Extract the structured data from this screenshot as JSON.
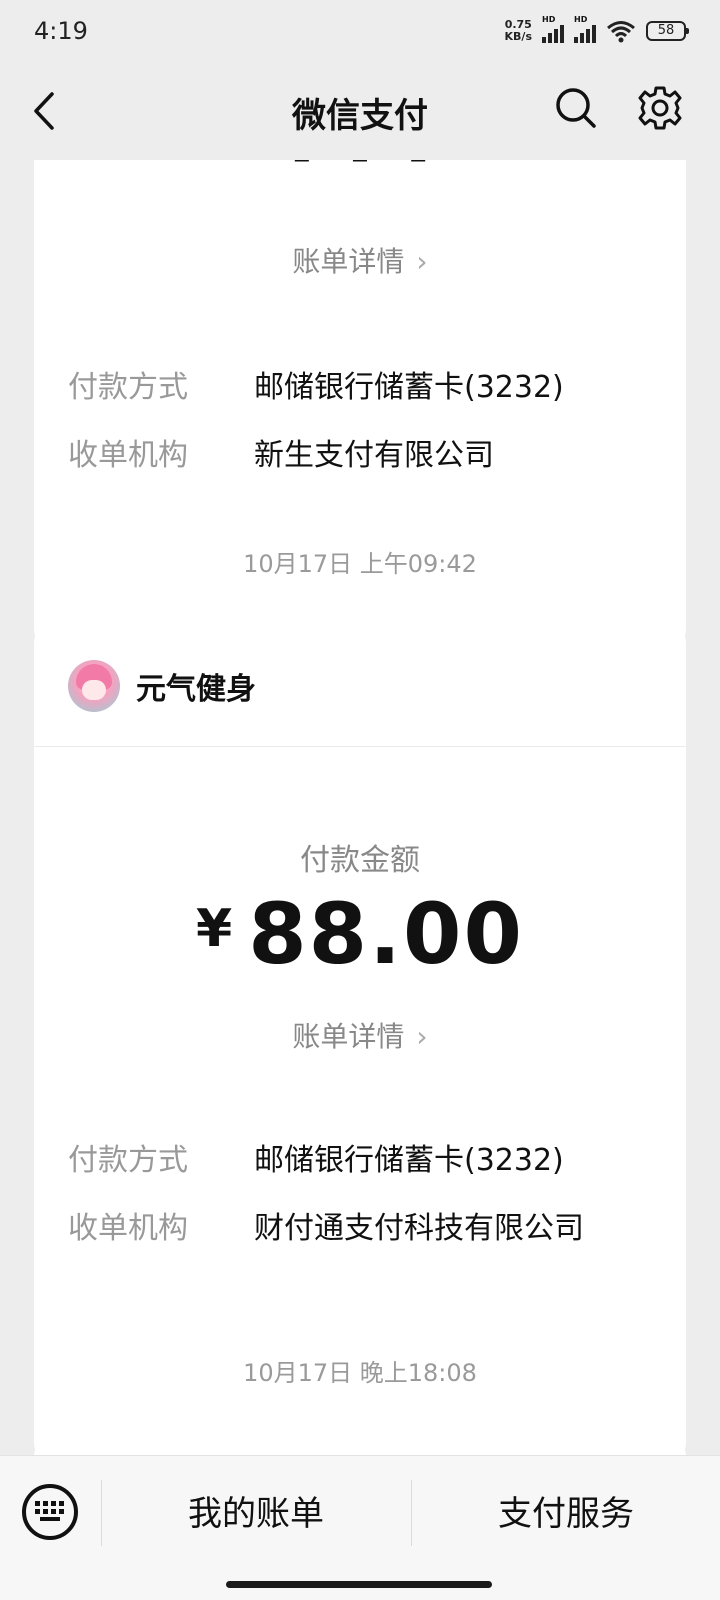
{
  "status_bar": {
    "time": "4:19",
    "net_speed_value": "0.75",
    "net_speed_unit": "KB/s",
    "signal_1_label": "HD",
    "signal_2_label": "HD",
    "battery": "58"
  },
  "nav": {
    "title": "微信支付",
    "back_icon": "chevron-left-icon",
    "search_icon": "search-icon",
    "settings_icon": "gear-icon"
  },
  "cards": [
    {
      "bill_detail_label": "账单详情",
      "payment_method_label": "付款方式",
      "payment_method_value": "邮储银行储蓄卡(3232)",
      "acquirer_label": "收单机构",
      "acquirer_value": "新生支付有限公司"
    },
    {
      "merchant_name": "元气健身",
      "amount_label": "付款金额",
      "currency": "¥",
      "amount": "88.00",
      "bill_detail_label": "账单详情",
      "payment_method_label": "付款方式",
      "payment_method_value": "邮储银行储蓄卡(3232)",
      "acquirer_label": "收单机构",
      "acquirer_value": "财付通支付科技有限公司"
    }
  ],
  "date_dividers": [
    "10月17日 上午09:42",
    "10月17日 晚上18:08"
  ],
  "bottom_bar": {
    "keyboard_icon": "keyboard-icon",
    "my_bills": "我的账单",
    "pay_services": "支付服务"
  },
  "colors": {
    "background": "#ededed",
    "card": "#ffffff",
    "label_gray": "#999999",
    "primary_text": "#111111"
  }
}
